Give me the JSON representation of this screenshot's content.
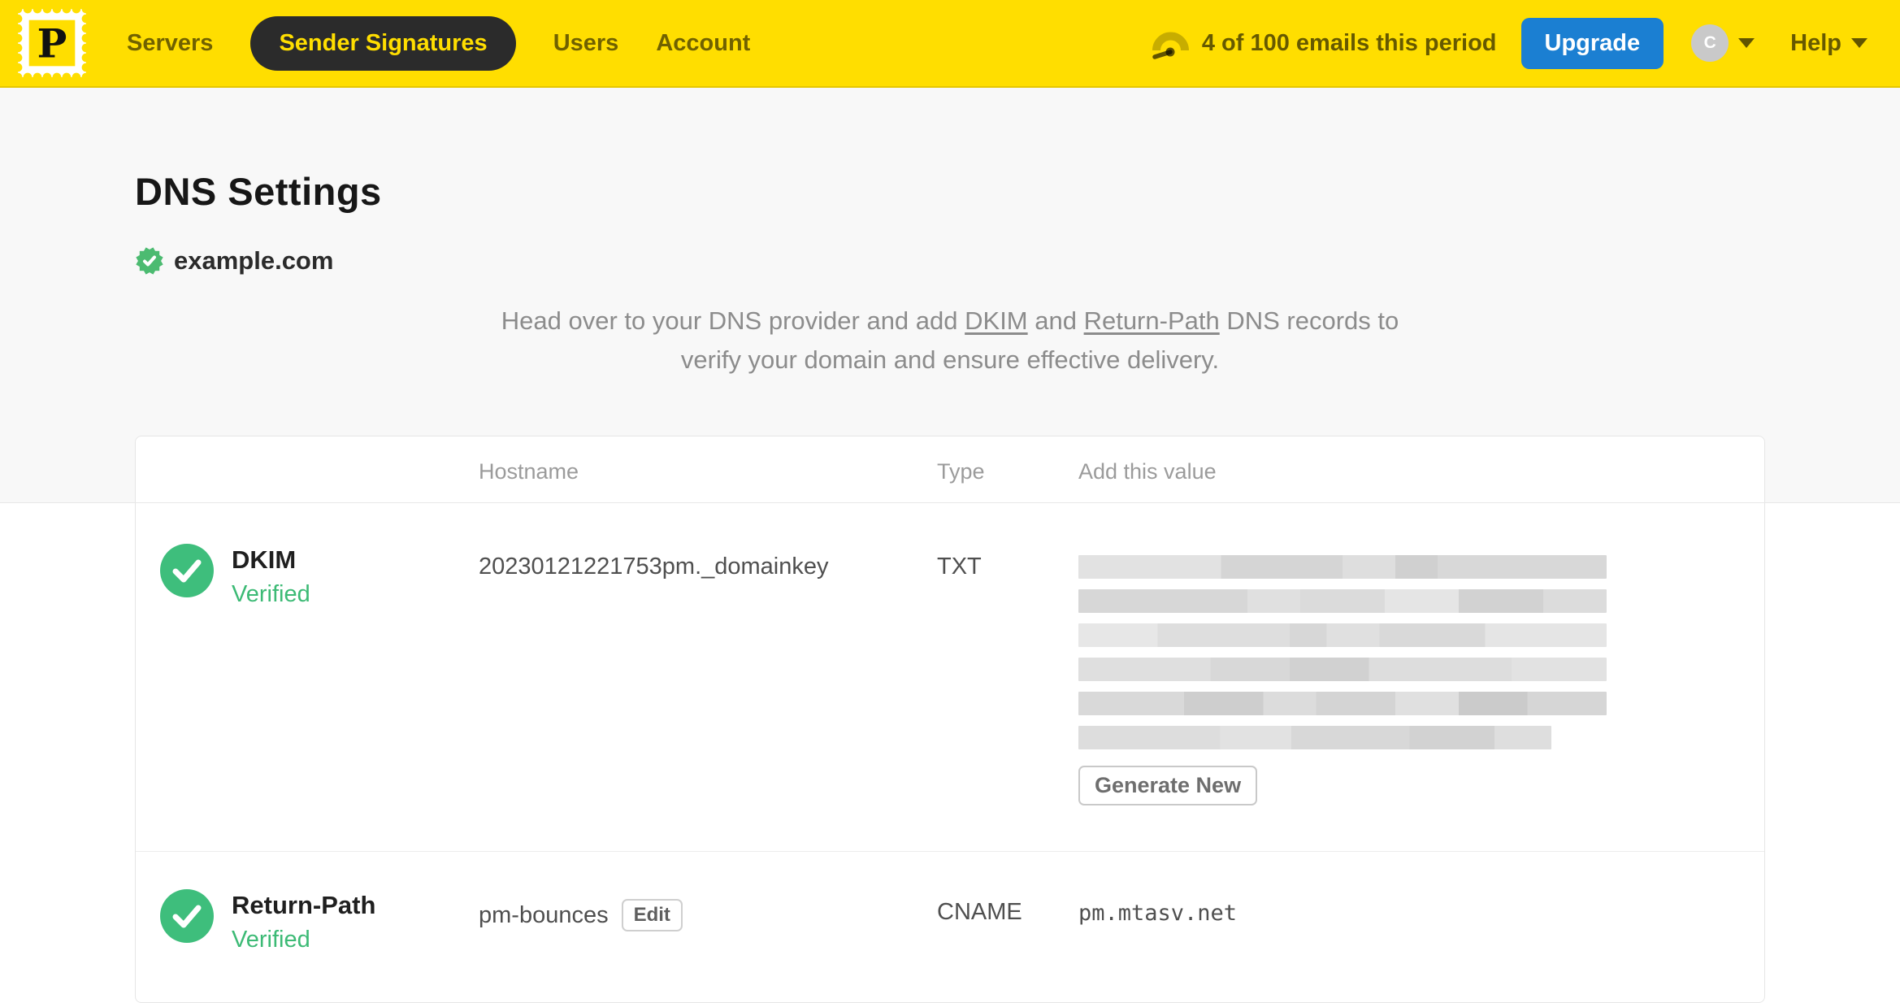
{
  "colors": {
    "brand_yellow": "#FFDE00",
    "nav_pill_dark": "#2B2B2B",
    "upgrade_blue": "#1B7FD2",
    "verified_green": "#3EBE7C",
    "page_bg": "#F8F8F8"
  },
  "nav": {
    "logo_letter": "P",
    "items": [
      {
        "label": "Servers",
        "active": false
      },
      {
        "label": "Sender Signatures",
        "active": true
      },
      {
        "label": "Users",
        "active": false
      },
      {
        "label": "Account",
        "active": false
      }
    ],
    "usage_text": "4 of 100 emails this period",
    "upgrade_label": "Upgrade",
    "avatar_initial": "C",
    "help_label": "Help"
  },
  "page": {
    "title": "DNS Settings",
    "domain": "example.com",
    "intro": {
      "pre": "Head over to your DNS provider and add ",
      "link_dkim": "DKIM",
      "mid": " and ",
      "link_return_path": "Return-Path",
      "tail": " DNS records to",
      "line2": "verify your domain and ensure effective delivery."
    }
  },
  "table": {
    "headers": {
      "hostname": "Hostname",
      "type": "Type",
      "value": "Add this value"
    },
    "rows": [
      {
        "name": "DKIM",
        "status": "Verified",
        "hostname": "20230121221753pm._domainkey",
        "type": "TXT",
        "value": "(redacted)",
        "action_label": "Generate New"
      },
      {
        "name": "Return-Path",
        "status": "Verified",
        "hostname": "pm-bounces",
        "edit_label": "Edit",
        "type": "CNAME",
        "value": "pm.mtasv.net"
      }
    ]
  }
}
